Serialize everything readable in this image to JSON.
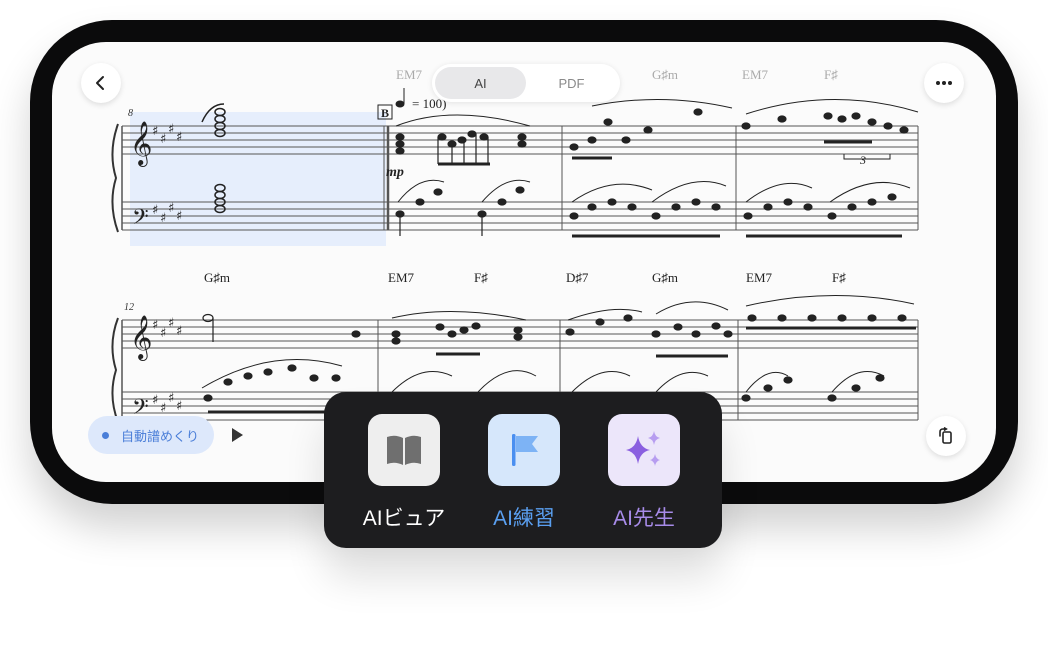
{
  "header": {
    "back_icon": "chevron-left-icon",
    "segmented": [
      "AI",
      "PDF"
    ],
    "selected_mode": "AI",
    "more_icon": "more-dots-icon"
  },
  "score": {
    "system1": {
      "measure_number": "8",
      "rehearsal_mark": "B",
      "tempo": "= 100)",
      "dynamic": "mp",
      "chords": [
        "EM7",
        "G♯m",
        "EM7",
        "F♯"
      ],
      "tuplet": "3"
    },
    "system2": {
      "measure_number": "12",
      "chords": [
        "G♯m",
        "EM7",
        "F♯",
        "D♯7",
        "G♯m",
        "EM7",
        "F♯"
      ]
    }
  },
  "bottom_bar": {
    "auto_page_turn": "自動譜めくり",
    "play_icon": "play-icon",
    "rotate_icon": "rotate-screen-icon"
  },
  "panel": {
    "items": [
      {
        "label": "AIビュア",
        "icon": "book-icon",
        "color": "#ffffff"
      },
      {
        "label": "AI練習",
        "icon": "flag-icon",
        "color": "#5a9ff0"
      },
      {
        "label": "AI先生",
        "icon": "sparkle-icon",
        "color": "#a78be8"
      }
    ]
  }
}
